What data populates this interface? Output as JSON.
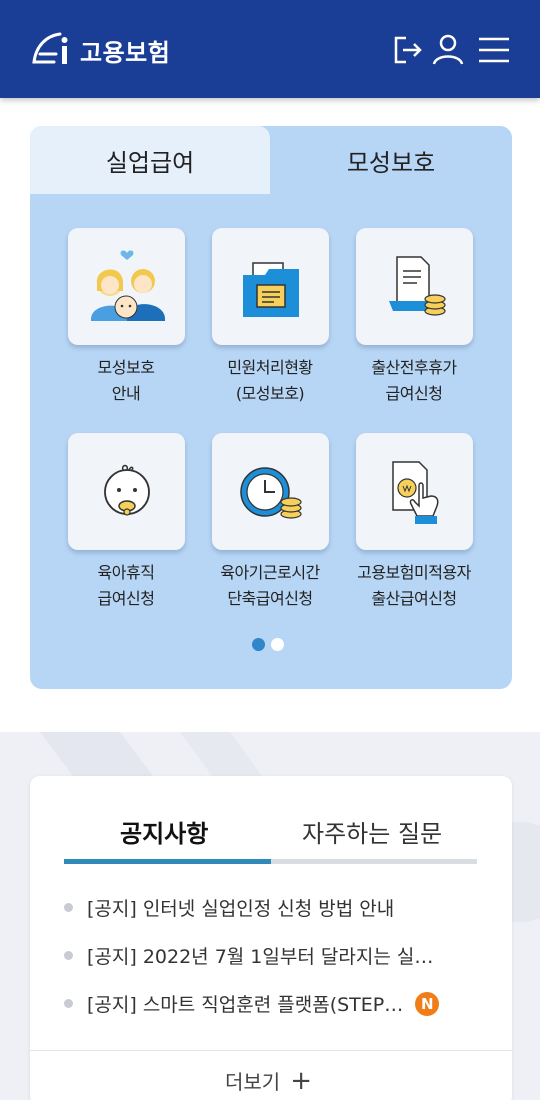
{
  "header": {
    "logo_text": "고용보험",
    "icons": [
      "logout-icon",
      "user-icon",
      "menu-icon"
    ],
    "background": "#1a3e96"
  },
  "panel": {
    "tabs": [
      {
        "label": "실업급여",
        "active": false
      },
      {
        "label": "모성보호",
        "active": true
      }
    ],
    "tiles": [
      {
        "icon": "family-icon",
        "line1": "모성보호",
        "line2": "안내"
      },
      {
        "icon": "folder-document-icon",
        "line1": "민원처리현황",
        "line2": "(모성보호)"
      },
      {
        "icon": "document-coins-icon",
        "line1": "출산전후휴가",
        "line2": "급여신청"
      },
      {
        "icon": "baby-icon",
        "line1": "육아휴직",
        "line2": "급여신청"
      },
      {
        "icon": "clock-coins-icon",
        "line1": "육아기근로시간",
        "line2": "단축급여신청"
      },
      {
        "icon": "hand-won-document-icon",
        "line1": "고용보험미적용자",
        "line2": "출산급여신청"
      }
    ],
    "page_indicator": {
      "pages": 2,
      "current": 1
    },
    "background": "#b7d6f5"
  },
  "notices": {
    "tabs": [
      {
        "label": "공지사항",
        "active": true
      },
      {
        "label": "자주하는 질문",
        "active": false
      }
    ],
    "items": [
      {
        "text": "[공지] 인터넷 실업인정 신청 방법 안내",
        "new": false
      },
      {
        "text": "[공지] 2022년 7월 1일부터 달라지는 실…",
        "new": false
      },
      {
        "text": "[공지] 스마트 직업훈련 플랫폼(STEP…",
        "new": true,
        "badge": "N"
      }
    ],
    "more_label": "더보기",
    "accent": "#2f8ab9",
    "badge_color": "#f07d18"
  }
}
